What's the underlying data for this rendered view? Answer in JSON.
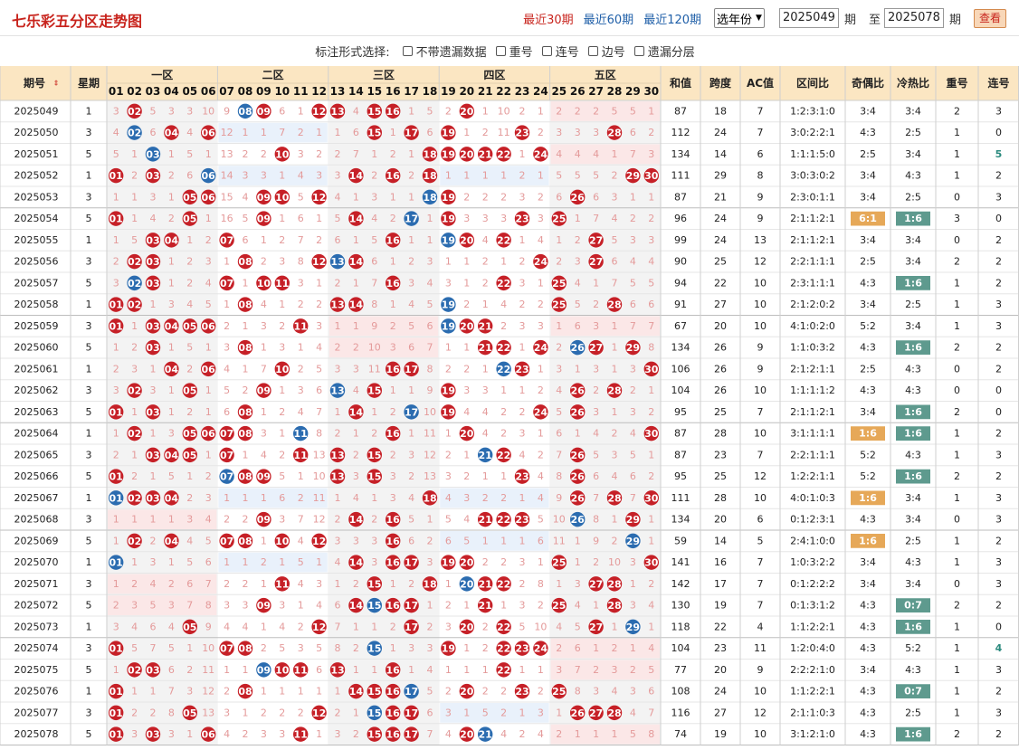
{
  "title": "七乐彩五分区走势图",
  "periods": [
    "最近30期",
    "最近60期",
    "最近120期"
  ],
  "year_select": "选年份",
  "range": {
    "from": "2025049",
    "to": "2025078",
    "unit": "期",
    "to_label": "至"
  },
  "view_button": "查看",
  "options_label": "标注形式选择:",
  "options": [
    "不带遗漏数据",
    "重号",
    "连号",
    "边号",
    "遗漏分层"
  ],
  "headers": {
    "period": "期号",
    "weekday": "星期",
    "zones": [
      "一区",
      "二区",
      "三区",
      "四区",
      "五区"
    ],
    "stats": [
      "和值",
      "跨度",
      "AC值",
      "区间比",
      "奇偶比",
      "冷热比",
      "重号",
      "连号"
    ]
  },
  "numbers": [
    "01",
    "02",
    "03",
    "04",
    "05",
    "06",
    "07",
    "08",
    "09",
    "10",
    "11",
    "12",
    "13",
    "14",
    "15",
    "16",
    "17",
    "18",
    "19",
    "20",
    "21",
    "22",
    "23",
    "24",
    "25",
    "26",
    "27",
    "28",
    "29",
    "30"
  ],
  "colors": {
    "red": "#c62027",
    "blue": "#2b6cb0",
    "orange": "#e6a858",
    "teal": "#5e9a8e",
    "zone_bg": "#f1f1f1",
    "miss_red": "#fde4e4",
    "miss_blue": "#e3eefa"
  },
  "rows": [
    {
      "p": "2025049",
      "w": "1",
      "c": "3 r:02 5 3 3 10 9 b:08 r:09 6 1 r:12 r:13 4 r:15 r:16 1 5 2 r:20 1 10 2 1 2 2 2 5 5 1",
      "s": [
        "87",
        "18",
        "7",
        "1:2:3:1:0",
        "3:4",
        "3:4",
        "2",
        "3"
      ]
    },
    {
      "p": "2025050",
      "w": "3",
      "c": "4 b:02 6 r:04 4 r:06 12 1 1 7 2 1 1 6 r:15 1 r:17 6 r:19 1 2 11 r:23 2 3 3 3 r:28 6 2",
      "s": [
        "112",
        "24",
        "7",
        "3:0:2:2:1",
        "4:3",
        "2:5",
        "1",
        "0"
      ]
    },
    {
      "p": "2025051",
      "w": "5",
      "c": "5 1 b:03 1 5 1 13 2 2 r:10 3 2 2 7 1 2 1 r:18 r:19 r:20 r:21 r:22 1 r:24 4 4 4 1 7 3",
      "s": [
        "134",
        "14",
        "6",
        "1:1:1:5:0",
        "2:5",
        "3:4",
        "1",
        "5"
      ]
    },
    {
      "p": "2025052",
      "w": "1",
      "c": "r:01 2 r:03 2 6 b:06 14 3 3 1 4 3 3 r:14 2 r:16 2 r:18 1 1 1 1 2 1 5 5 5 2 r:29 r:30",
      "s": [
        "111",
        "29",
        "8",
        "3:0:3:0:2",
        "3:4",
        "4:3",
        "1",
        "2"
      ]
    },
    {
      "p": "2025053",
      "w": "3",
      "c": "1 1 3 1 r:05 r:06 15 4 r:09 r:10 5 r:12 4 1 3 1 1 b:18 r:19 2 2 2 3 2 6 r:26 6 3 1 1",
      "s": [
        "87",
        "21",
        "9",
        "2:3:0:1:1",
        "3:4",
        "2:5",
        "0",
        "3"
      ]
    },
    {
      "p": "2025054",
      "w": "5",
      "c": "r:01 1 4 2 r:05 1 16 5 r:09 1 6 1 5 r:14 4 2 b:17 1 r:19 3 3 3 r:23 3 r:25 1 7 4 2 2",
      "s": [
        "96",
        "24",
        "9",
        "2:1:1:2:1",
        "6:1",
        "1:6",
        "3",
        "0"
      ]
    },
    {
      "p": "2025055",
      "w": "1",
      "c": "1 5 r:03 r:04 1 2 r:07 6 1 2 7 2 6 1 5 r:16 1 1 b:19 r:20 4 r:22 1 4 1 2 r:27 5 3 3",
      "s": [
        "99",
        "24",
        "13",
        "2:1:1:2:1",
        "3:4",
        "3:4",
        "0",
        "2"
      ]
    },
    {
      "p": "2025056",
      "w": "3",
      "c": "2 r:02 r:03 1 2 3 1 r:08 2 3 8 r:12 b:13 r:14 6 1 2 3 1 1 2 1 2 r:24 2 3 r:27 6 4 4",
      "s": [
        "90",
        "25",
        "12",
        "2:2:1:1:1",
        "2:5",
        "3:4",
        "2",
        "2"
      ]
    },
    {
      "p": "2025057",
      "w": "5",
      "c": "3 b:02 r:03 1 2 4 r:07 1 r:10 r:11 3 1 2 1 7 r:16 3 4 3 1 2 r:22 3 1 r:25 4 1 7 5 5",
      "s": [
        "94",
        "22",
        "10",
        "2:3:1:1:1",
        "4:3",
        "1:6",
        "1",
        "2"
      ]
    },
    {
      "p": "2025058",
      "w": "1",
      "c": "r:01 r:02 1 3 4 5 1 r:08 4 1 2 2 r:13 r:14 8 1 4 5 b:19 2 1 4 2 2 r:25 5 2 r:28 6 6",
      "s": [
        "91",
        "27",
        "10",
        "2:1:2:0:2",
        "3:4",
        "2:5",
        "1",
        "3"
      ]
    },
    {
      "p": "2025059",
      "w": "3",
      "c": "r:01 1 r:03 r:04 r:05 r:06 2 1 3 2 r:11 3 1 1 9 2 5 6 b:19 r:20 r:21 2 3 3 1 6 3 1 7 7",
      "s": [
        "67",
        "20",
        "10",
        "4:1:0:2:0",
        "5:2",
        "3:4",
        "1",
        "3"
      ]
    },
    {
      "p": "2025060",
      "w": "5",
      "c": "1 2 r:03 1 5 1 3 r:08 1 3 1 4 2 2 10 3 6 7 1 1 r:21 r:22 1 r:24 2 b:26 r:27 1 r:29 8",
      "s": [
        "134",
        "26",
        "9",
        "1:1:0:3:2",
        "4:3",
        "1:6",
        "2",
        "2"
      ]
    },
    {
      "p": "2025061",
      "w": "1",
      "c": "2 3 1 r:04 2 r:06 4 1 7 r:10 2 5 3 3 11 r:16 r:17 8 2 2 1 b:22 r:23 1 3 1 3 1 3 r:30",
      "s": [
        "106",
        "26",
        "9",
        "2:1:2:1:1",
        "2:5",
        "4:3",
        "0",
        "2"
      ]
    },
    {
      "p": "2025062",
      "w": "3",
      "c": "3 r:02 3 1 r:05 1 5 2 r:09 1 3 6 b:13 4 r:15 1 1 9 r:19 3 3 1 1 2 4 r:26 2 r:28 2 1",
      "s": [
        "104",
        "26",
        "10",
        "1:1:1:1:2",
        "4:3",
        "4:3",
        "0",
        "0"
      ]
    },
    {
      "p": "2025063",
      "w": "5",
      "c": "r:01 1 r:03 1 2 1 6 r:08 1 2 4 7 1 r:14 1 2 b:17 10 r:19 4 4 2 2 r:24 5 r:26 3 1 3 2",
      "s": [
        "95",
        "25",
        "7",
        "2:1:1:2:1",
        "3:4",
        "1:6",
        "2",
        "0"
      ]
    },
    {
      "p": "2025064",
      "w": "1",
      "c": "1 r:02 1 3 r:05 r:06 r:07 r:08 3 1 b:11 8 2 1 2 r:16 1 11 1 r:20 4 2 3 1 6 1 4 2 4 r:30",
      "s": [
        "87",
        "28",
        "10",
        "3:1:1:1:1",
        "1:6",
        "1:6",
        "1",
        "2"
      ]
    },
    {
      "p": "2025065",
      "w": "3",
      "c": "2 1 r:03 r:04 r:05 1 r:07 1 4 2 r:11 13 r:13 2 r:15 2 3 12 2 1 b:21 r:22 4 2 7 r:26 5 3 5 1",
      "s": [
        "87",
        "23",
        "7",
        "2:2:1:1:1",
        "5:2",
        "4:3",
        "1",
        "3"
      ]
    },
    {
      "p": "2025066",
      "w": "5",
      "c": "r:01 2 1 5 1 2 b:07 r:08 r:09 5 1 10 r:13 3 r:15 3 2 13 3 2 1 1 r:23 4 8 r:26 6 4 6 2",
      "s": [
        "95",
        "25",
        "12",
        "1:2:2:1:1",
        "5:2",
        "1:6",
        "2",
        "2"
      ]
    },
    {
      "p": "2025067",
      "w": "1",
      "c": "b:01 r:02 r:03 r:04 2 3 1 1 1 6 2 11 1 4 1 3 4 r:18 4 3 2 2 1 4 9 r:26 7 r:28 7 r:30",
      "s": [
        "111",
        "28",
        "10",
        "4:0:1:0:3",
        "1:6",
        "3:4",
        "1",
        "3"
      ]
    },
    {
      "p": "2025068",
      "w": "3",
      "c": "1 1 1 1 3 4 2 2 r:09 3 7 12 2 r:14 2 r:16 5 1 5 4 r:21 r:22 r:23 5 10 b:26 8 1 r:29 1",
      "s": [
        "134",
        "20",
        "6",
        "0:1:2:3:1",
        "4:3",
        "3:4",
        "0",
        "3"
      ]
    },
    {
      "p": "2025069",
      "w": "5",
      "c": "1 r:02 2 r:04 4 5 r:07 r:08 1 r:10 4 r:12 3 3 3 r:16 6 2 6 5 1 1 1 6 11 1 9 2 b:29 1",
      "s": [
        "59",
        "14",
        "5",
        "2:4:1:0:0",
        "1:6",
        "2:5",
        "1",
        "2"
      ]
    },
    {
      "p": "2025070",
      "w": "1",
      "c": "b:01 1 3 1 5 6 1 1 2 1 5 1 4 r:14 3 r:16 r:17 3 r:19 r:20 2 2 3 1 r:25 1 2 10 3 r:30",
      "s": [
        "141",
        "16",
        "7",
        "1:0:3:2:2",
        "3:4",
        "4:3",
        "1",
        "3"
      ]
    },
    {
      "p": "2025071",
      "w": "3",
      "c": "1 2 4 2 6 7 2 2 1 r:11 4 3 1 2 r:15 1 2 r:18 1 b:20 r:21 r:22 2 8 1 3 r:27 r:28 1 2",
      "s": [
        "142",
        "17",
        "7",
        "0:1:2:2:2",
        "3:4",
        "3:4",
        "0",
        "3"
      ]
    },
    {
      "p": "2025072",
      "w": "5",
      "c": "2 3 5 3 7 8 3 3 r:09 3 1 4 6 r:14 b:15 r:16 r:17 1 2 1 r:21 1 3 2 r:25 4 1 r:28 3 4",
      "s": [
        "130",
        "19",
        "7",
        "0:1:3:1:2",
        "4:3",
        "0:7",
        "2",
        "2"
      ]
    },
    {
      "p": "2025073",
      "w": "1",
      "c": "3 4 6 4 r:05 9 4 4 1 4 2 r:12 7 1 1 2 r:17 2 3 r:20 2 r:22 5 10 4 5 r:27 1 b:29 1",
      "s": [
        "118",
        "22",
        "4",
        "1:1:2:2:1",
        "4:3",
        "1:6",
        "1",
        "0"
      ]
    },
    {
      "p": "2025074",
      "w": "3",
      "c": "r:01 5 7 5 1 10 r:07 r:08 2 5 3 5 8 2 b:15 1 3 3 r:19 1 2 r:22 r:23 r:24 2 6 1 2 1 4",
      "s": [
        "104",
        "23",
        "11",
        "1:2:0:4:0",
        "4:3",
        "5:2",
        "1",
        "4"
      ]
    },
    {
      "p": "2025075",
      "w": "5",
      "c": "1 r:02 r:03 6 2 11 1 1 b:09 r:10 r:11 6 r:13 1 1 r:16 1 4 1 1 1 r:22 1 1 3 7 2 3 2 5",
      "s": [
        "77",
        "20",
        "9",
        "2:2:2:1:0",
        "3:4",
        "4:3",
        "1",
        "3"
      ]
    },
    {
      "p": "2025076",
      "w": "1",
      "c": "r:01 1 1 7 3 12 2 r:08 1 1 1 1 1 r:14 r:15 r:16 b:17 5 2 r:20 2 2 r:23 2 r:25 8 3 4 3 6",
      "s": [
        "108",
        "24",
        "10",
        "1:1:2:2:1",
        "4:3",
        "0:7",
        "1",
        "2"
      ]
    },
    {
      "p": "2025077",
      "w": "3",
      "c": "r:01 2 2 8 r:05 13 3 1 2 2 2 r:12 2 1 b:15 r:16 r:17 6 3 1 5 2 1 3 1 r:26 r:27 r:28 4 7",
      "s": [
        "116",
        "27",
        "12",
        "2:1:1:0:3",
        "4:3",
        "2:5",
        "1",
        "3"
      ]
    },
    {
      "p": "2025078",
      "w": "5",
      "c": "r:01 3 r:03 3 1 r:06 4 2 3 3 r:11 1 3 2 r:15 r:16 r:17 7 4 r:20 b:21 4 2 4 2 1 1 1 5 8",
      "s": [
        "74",
        "19",
        "10",
        "3:1:2:1:0",
        "4:3",
        "1:6",
        "2",
        "2"
      ]
    }
  ],
  "highlights": [
    {
      "row": 5,
      "col": 4,
      "type": "orange"
    },
    {
      "row": 5,
      "col": 5,
      "type": "teal"
    },
    {
      "row": 8,
      "col": 5,
      "type": "teal"
    },
    {
      "row": 11,
      "col": 5,
      "type": "teal"
    },
    {
      "row": 14,
      "col": 5,
      "type": "teal"
    },
    {
      "row": 15,
      "col": 4,
      "type": "orange"
    },
    {
      "row": 15,
      "col": 5,
      "type": "teal"
    },
    {
      "row": 17,
      "col": 5,
      "type": "teal"
    },
    {
      "row": 18,
      "col": 4,
      "type": "orange"
    },
    {
      "row": 20,
      "col": 4,
      "type": "orange"
    },
    {
      "row": 23,
      "col": 5,
      "type": "teal"
    },
    {
      "row": 24,
      "col": 5,
      "type": "teal"
    },
    {
      "row": 27,
      "col": 5,
      "type": "teal"
    },
    {
      "row": 29,
      "col": 5,
      "type": "teal"
    }
  ],
  "lianhao_colored": [
    {
      "row": 2,
      "color": "#2b8a7e"
    },
    {
      "row": 25,
      "color": "#2b8a7e"
    }
  ]
}
